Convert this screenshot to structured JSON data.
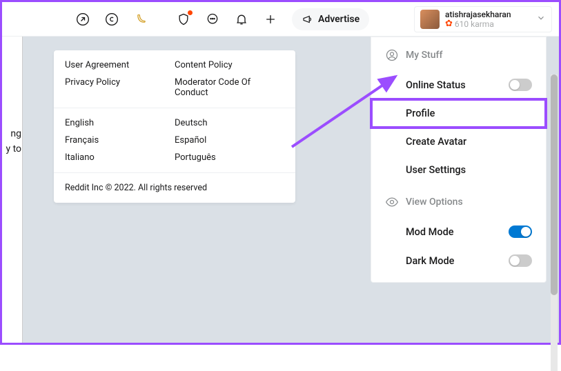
{
  "header": {
    "advertise_label": "Advertise",
    "user": {
      "name": "atishrajasekharan",
      "karma_text": "610 karma"
    }
  },
  "leftText": {
    "line1": "ng",
    "line2": "y to"
  },
  "footer": {
    "links1": {
      "colA": [
        "User Agreement",
        "Privacy Policy"
      ],
      "colB": [
        "Content Policy",
        "Moderator Code Of Conduct"
      ]
    },
    "links2": {
      "colA": [
        "English",
        "Français",
        "Italiano"
      ],
      "colB": [
        "Deutsch",
        "Español",
        "Português"
      ]
    },
    "copyright": "Reddit Inc © 2022. All rights reserved"
  },
  "dropdown": {
    "section1": {
      "title": "My Stuff",
      "online_status": "Online Status",
      "profile": "Profile",
      "create_avatar": "Create Avatar",
      "user_settings": "User Settings"
    },
    "section2": {
      "title": "View Options",
      "mod_mode": "Mod Mode",
      "dark_mode": "Dark Mode"
    }
  }
}
